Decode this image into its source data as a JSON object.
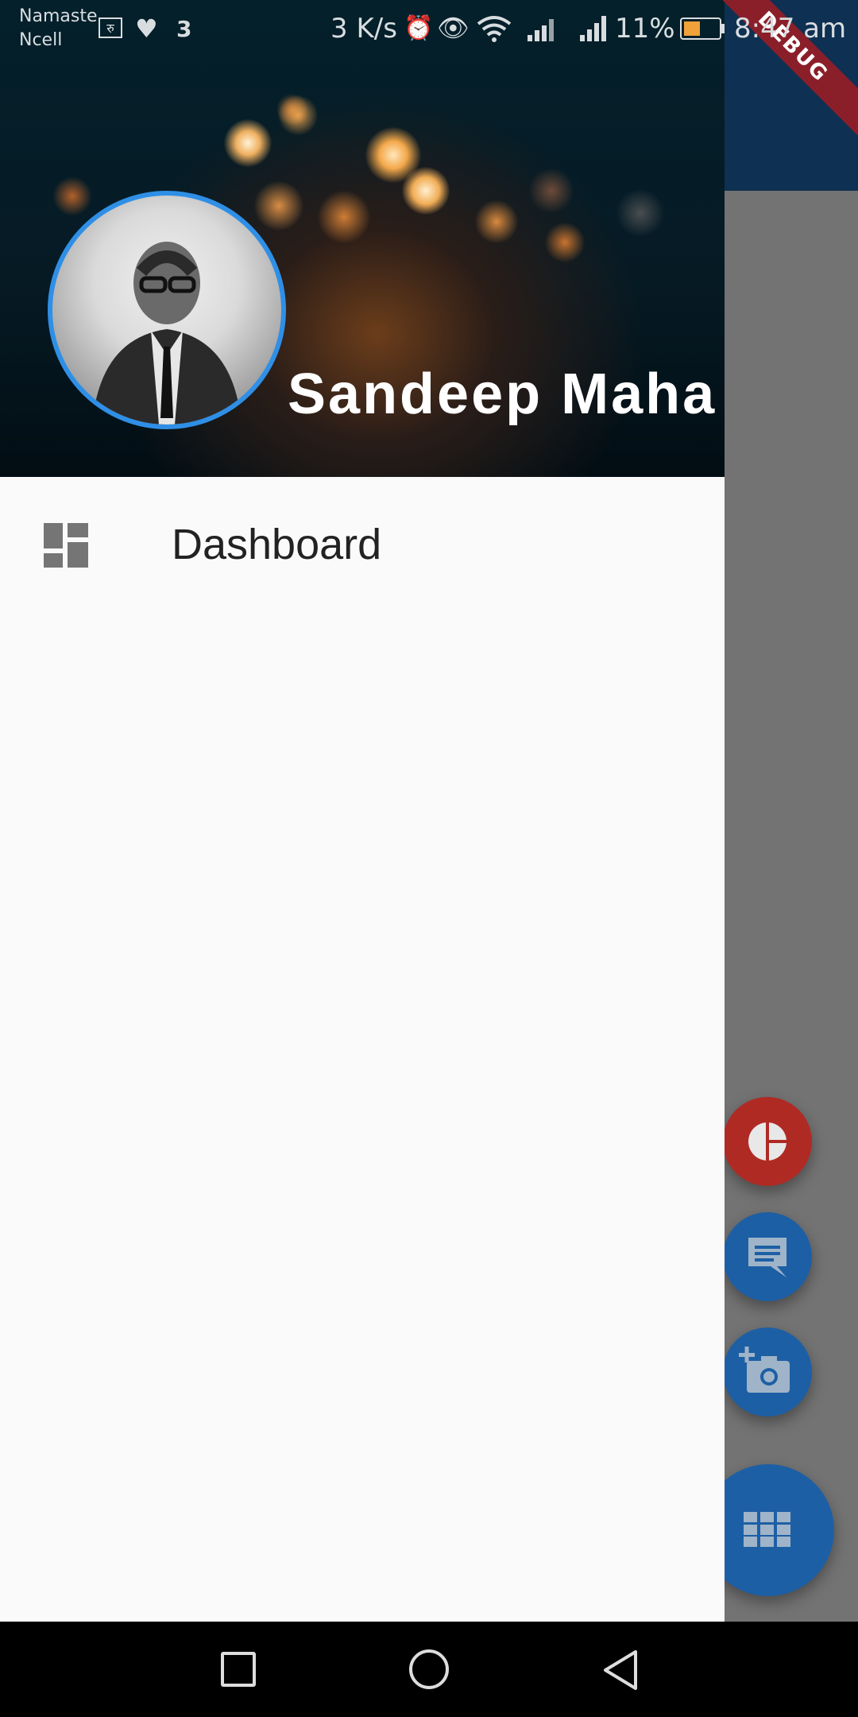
{
  "status_bar": {
    "carrier_line1": "Namaste",
    "carrier_line2": "Ncell",
    "rs_badge": "रु",
    "notification_count": "3",
    "net_speed": "3 K/s",
    "battery_percent": "11%",
    "time": "8:47 am"
  },
  "debug_banner": "DEBUG",
  "drawer": {
    "user_name": "Sandeep Maha",
    "menu_items": [
      {
        "label": "Dashboard",
        "icon": "dashboard-icon"
      }
    ]
  },
  "fabs": [
    {
      "icon": "pie-chart-icon",
      "color": "#b02a24"
    },
    {
      "icon": "chat-icon",
      "color": "#1d5fa5"
    },
    {
      "icon": "add-a-photo-icon",
      "color": "#1d5fa5"
    },
    {
      "icon": "apps-grid-icon",
      "color": "#1d5fa5"
    }
  ],
  "colors": {
    "app_bar": "#1f6ab4",
    "avatar_border": "#2f8fe6",
    "scrim": "rgba(0,0,0,0.54)"
  }
}
